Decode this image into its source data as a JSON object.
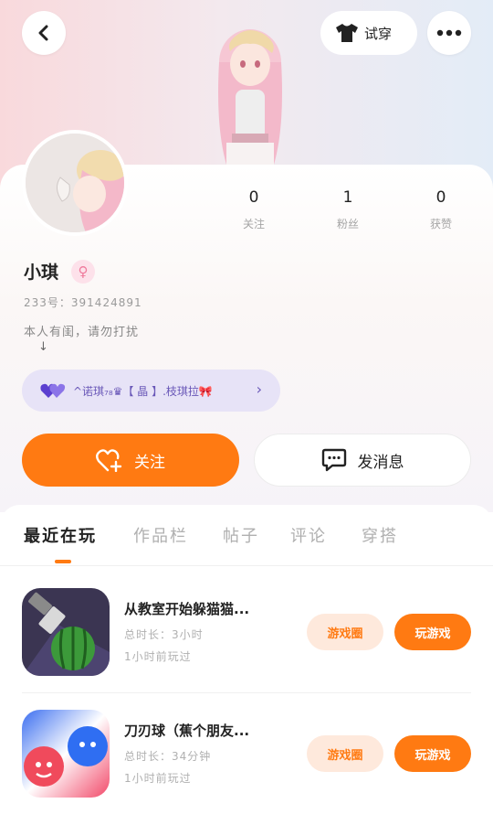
{
  "header": {
    "tryon_label": "试穿",
    "icons": {
      "back": "chevron-left-icon",
      "more": "more-dots-icon",
      "shirt": "shirt-icon"
    }
  },
  "profile": {
    "name": "小琪",
    "gender": "female",
    "gender_symbol": "♀",
    "account_id": "233号：391424891",
    "bio": "本人有闺，请勿打扰",
    "bio_arrow": "↓",
    "stats": [
      {
        "value": "0",
        "label": "关注"
      },
      {
        "value": "1",
        "label": "粉丝"
      },
      {
        "value": "0",
        "label": "获赞"
      }
    ],
    "club": {
      "text": "^诺琪₇₈♛【 晶 】.枝琪拉🎀",
      "chevron": "›"
    }
  },
  "actions": {
    "follow_label": "关注",
    "message_label": "发消息"
  },
  "tabs": [
    {
      "label": "最近在玩",
      "active": true
    },
    {
      "label": "作品栏",
      "active": false
    },
    {
      "label": "帖子",
      "active": false
    },
    {
      "label": "评论",
      "active": false
    },
    {
      "label": "穿搭",
      "active": false
    }
  ],
  "games": [
    {
      "title": "从教室开始躲猫猫...",
      "play_time": "总时长：3小时",
      "last_played": "1小时前玩过",
      "circle_label": "游戏圈",
      "play_label": "玩游戏"
    },
    {
      "title": "刀刃球（蕉个朋友...",
      "play_time": "总时长：34分钟",
      "last_played": "1小时前玩过",
      "circle_label": "游戏圈",
      "play_label": "玩游戏"
    }
  ],
  "colors": {
    "accent": "#ff7a12",
    "accent_light": "#fee9dc",
    "club_bg": "#e7e3f7",
    "club_text": "#6a58b8"
  }
}
